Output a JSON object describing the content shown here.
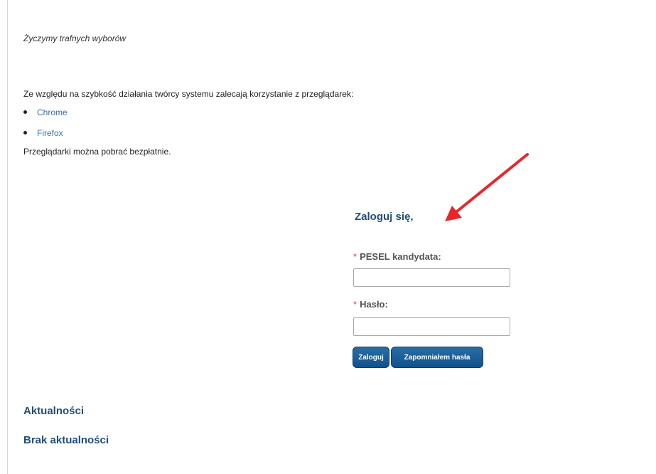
{
  "greeting": "Życzymy trafnych wyborów",
  "browsers": {
    "intro": "Ze względu na szybkość działania twórcy systemu zalecają korzystanie z przeglądarek:",
    "items": [
      {
        "label": "Chrome"
      },
      {
        "label": "Firefox"
      }
    ],
    "free_note": "Przeglądarki można pobrać bezpłatnie."
  },
  "login": {
    "title": "Zaloguj się,",
    "required_mark": "*",
    "pesel_label": "PESEL kandydata:",
    "pesel_value": "",
    "password_label": "Hasło:",
    "password_value": "",
    "login_button": "Zaloguj",
    "forgot_button": "Zapomniałem hasła"
  },
  "news": {
    "heading": "Aktualności",
    "empty_text": "Brak aktualności"
  },
  "annotation": {
    "arrow_color": "#e8262a",
    "arrow_icon": "red-arrow-icon"
  },
  "colors": {
    "heading": "#1f4e79",
    "link": "#3a6fa8",
    "button": "#10528c",
    "required": "#e04343"
  }
}
